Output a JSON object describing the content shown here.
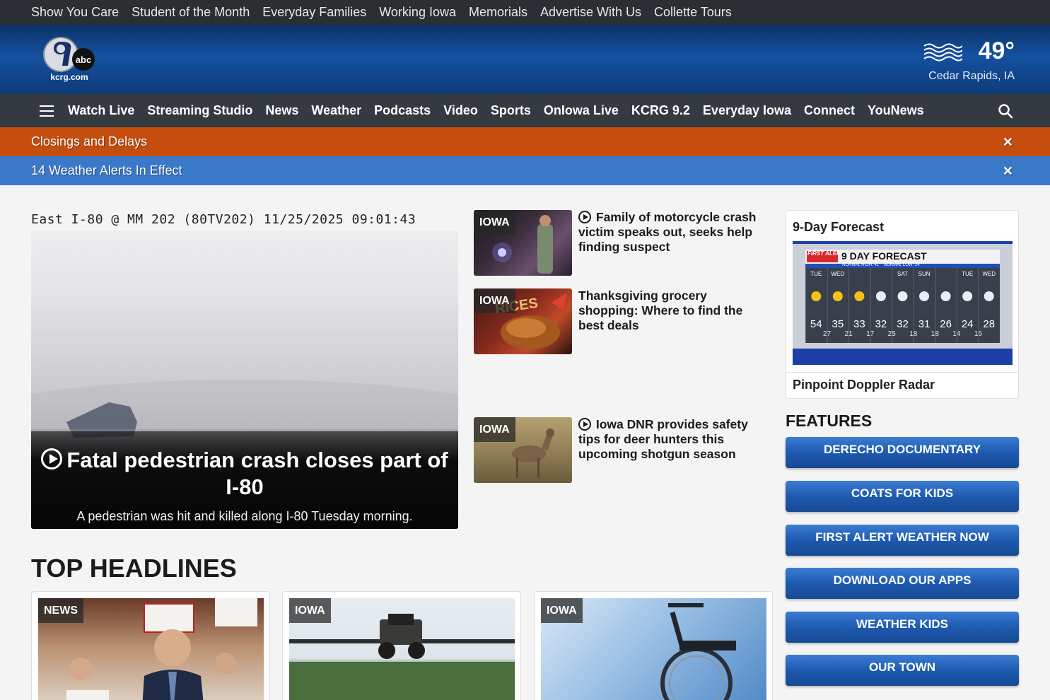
{
  "topbar": {
    "links": [
      "Show You Care",
      "Student of the Month",
      "Everyday Families",
      "Working Iowa",
      "Memorials",
      "Advertise With Us",
      "Collette Tours"
    ]
  },
  "header": {
    "logo_text": "abc kcrg.com",
    "temperature": "49°",
    "location": "Cedar Rapids, IA"
  },
  "nav": {
    "items": [
      "Watch Live",
      "Streaming Studio",
      "News",
      "Weather",
      "Podcasts",
      "Video",
      "Sports",
      "OnIowa Live",
      "KCRG 9.2",
      "Everyday Iowa",
      "Connect",
      "YouNews"
    ]
  },
  "alerts": {
    "closings": "Closings and Delays",
    "weather": "14 Weather Alerts In Effect",
    "close_symbol": "✕"
  },
  "hero": {
    "cam_label": "East   I-80 @ MM 202 (80TV202) 11/25/2025 09:01:43",
    "title": "Fatal pedestrian crash closes part of I-80",
    "subtitle": "A pedestrian was hit and killed along I-80 Tuesday morning."
  },
  "stories": [
    {
      "tag": "IOWA",
      "title": "Family of motorcycle crash victim speaks out, seeks help finding suspect",
      "video": true
    },
    {
      "tag": "IOWA",
      "title": "Thanksgiving grocery shopping: Where to find the best deals",
      "video": false,
      "thumb_text": "RICES"
    },
    {
      "tag": "IOWA",
      "title": "Iowa DNR provides safety tips for deer hunters this upcoming shotgun season",
      "video": true
    }
  ],
  "forecast": {
    "title": "9-Day Forecast",
    "graphic_title": "9 DAY FORECAST",
    "graphic_brand": "FIRST ALERT",
    "normals": "NORMAL HIGH: 41    NORMAL LOW: 24",
    "days": [
      "TUE",
      "WED",
      "",
      "",
      "SAT",
      "SUN",
      "",
      "TUE",
      "WED"
    ],
    "highs": [
      "54",
      "35",
      "33",
      "32",
      "32",
      "31",
      "26",
      "24",
      "28"
    ],
    "lows": [
      "27",
      "21",
      "17",
      "25",
      "18",
      "18",
      "14",
      "16",
      ""
    ],
    "radar_link": "Pinpoint Doppler Radar"
  },
  "features": {
    "title": "FEATURES",
    "buttons": [
      "DERECHO DOCUMENTARY",
      "COATS FOR KIDS",
      "FIRST ALERT WEATHER NOW",
      "DOWNLOAD OUR APPS",
      "WEATHER KIDS",
      "OUR TOWN"
    ]
  },
  "top_headlines": {
    "title": "TOP HEADLINES",
    "cards": [
      {
        "tag": "NEWS"
      },
      {
        "tag": "IOWA"
      },
      {
        "tag": "IOWA"
      }
    ]
  },
  "colors": {
    "orange_alert": "#c54e0e",
    "blue_alert": "#3a78c9",
    "nav_bg": "#343a40",
    "feature_button": "#1e5ab0"
  }
}
